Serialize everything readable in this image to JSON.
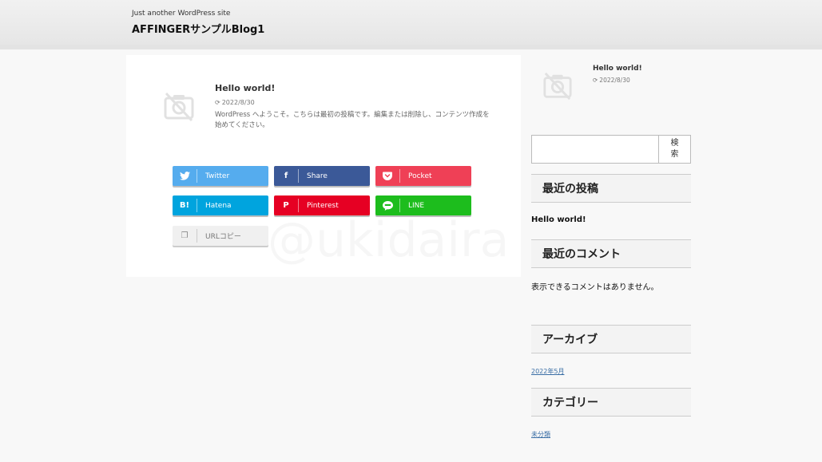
{
  "header": {
    "tagline": "Just another WordPress site",
    "site_title": "AFFINGERサンプルBlog1"
  },
  "post": {
    "title": "Hello world!",
    "date": "2022/8/30",
    "excerpt": "WordPress へようこそ。こちらは最初の投稿です。編集または削除し、コンテンツ作成を始めてください。"
  },
  "share_buttons": [
    {
      "label": "Twitter",
      "icon": "twitter-icon",
      "glyph": "🐦",
      "color": "#55acee"
    },
    {
      "label": "Share",
      "icon": "facebook-icon",
      "glyph": "f",
      "color": "#3b5998"
    },
    {
      "label": "Pocket",
      "icon": "pocket-icon",
      "glyph": "❤",
      "color": "#ef4056"
    },
    {
      "label": "Hatena",
      "icon": "hatena-icon",
      "glyph": "B!",
      "color": "#00a4de"
    },
    {
      "label": "Pinterest",
      "icon": "pinterest-icon",
      "glyph": "P",
      "color": "#e60023"
    },
    {
      "label": "LINE",
      "icon": "line-icon",
      "glyph": "●",
      "color": "#1dbd1d"
    },
    {
      "label": "URLコピー",
      "icon": "copy-icon",
      "glyph": "❐",
      "color": "#f0f0f0"
    }
  ],
  "watermark": "@ukidaira",
  "sidebar": {
    "recent_thumb_post": {
      "title": "Hello world!",
      "date": "2022/8/30"
    },
    "search": {
      "button_label": "検索"
    },
    "recent_posts": {
      "heading": "最近の投稿",
      "items": [
        "Hello world!"
      ]
    },
    "recent_comments": {
      "heading": "最近のコメント",
      "empty_text": "表示できるコメントはありません。"
    },
    "archives": {
      "heading": "アーカイブ",
      "items": [
        "2022年5月"
      ]
    },
    "categories": {
      "heading": "カテゴリー",
      "items": [
        "未分類"
      ]
    }
  }
}
